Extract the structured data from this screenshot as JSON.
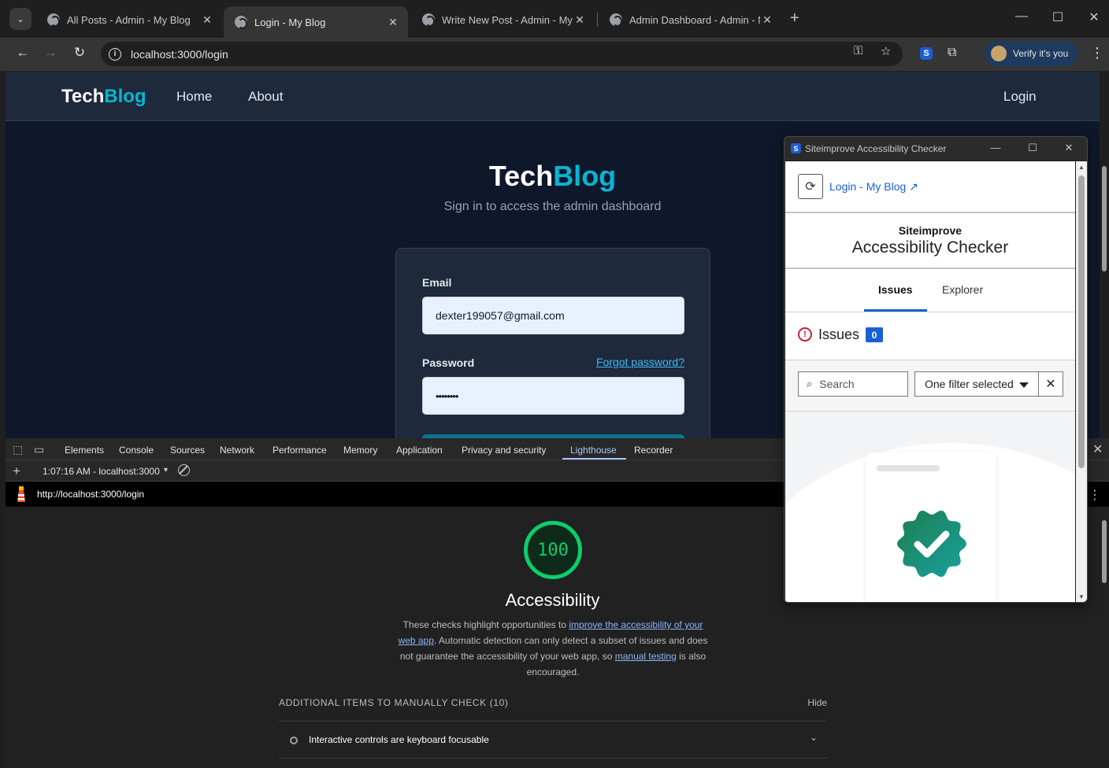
{
  "browser": {
    "tabs": [
      {
        "title": "All Posts - Admin - My Blog",
        "active": false
      },
      {
        "title": "Login - My Blog",
        "active": true
      },
      {
        "title": "Write New Post - Admin - My Blo",
        "active": false
      },
      {
        "title": "Admin Dashboard - Admin - My",
        "active": false
      }
    ],
    "url": "localhost:3000/login",
    "profile_label": "Verify it's you",
    "extension_letter": "S"
  },
  "site": {
    "brand_part1": "Tech",
    "brand_part2": "Blog",
    "nav": {
      "home": "Home",
      "about": "About",
      "login": "Login"
    },
    "hero_subtitle": "Sign in to access the admin dashboard",
    "form": {
      "email_label": "Email",
      "email_value": "dexter199057@gmail.com",
      "password_label": "Password",
      "forgot_label": "Forgot password?",
      "password_mask": "••••••••"
    }
  },
  "devtools": {
    "tabs": [
      "Elements",
      "Console",
      "Sources",
      "Network",
      "Performance",
      "Memory",
      "Application",
      "Privacy and security",
      "Lighthouse",
      "Recorder"
    ],
    "active_tab": "Lighthouse",
    "report_selector": "1:07:16 AM - localhost:3000",
    "report_url": "http://localhost:3000/login",
    "lighthouse": {
      "score": "100",
      "category": "Accessibility",
      "desc_part1": "These checks highlight opportunities to ",
      "desc_link1": "improve the accessibility of your web app",
      "desc_part2": ". Automatic detection can only detect a subset of issues and does not guarantee the accessibility of your web app, so ",
      "desc_link2": "manual testing",
      "desc_part3": " is also encouraged.",
      "manual_header": "ADDITIONAL ITEMS TO MANUALLY CHECK (10)",
      "hide_label": "Hide",
      "audits": [
        "Interactive controls are keyboard focusable"
      ]
    }
  },
  "siteimprove": {
    "window_title": "Siteimprove Accessibility Checker",
    "page_link": "Login - My Blog ↗",
    "brand_top": "Siteimprove",
    "brand_bottom": "Accessibility Checker",
    "tabs": {
      "issues": "Issues",
      "explorer": "Explorer"
    },
    "issues_label": "Issues",
    "issues_count": "0",
    "search_placeholder": "Search",
    "filter_label": "One filter selected"
  },
  "colors": {
    "accent_cyan": "#06b6d4",
    "lighthouse_green": "#0cce6b",
    "siteimprove_blue": "#1a5fd3",
    "badge_green": "#1a9a6c"
  }
}
